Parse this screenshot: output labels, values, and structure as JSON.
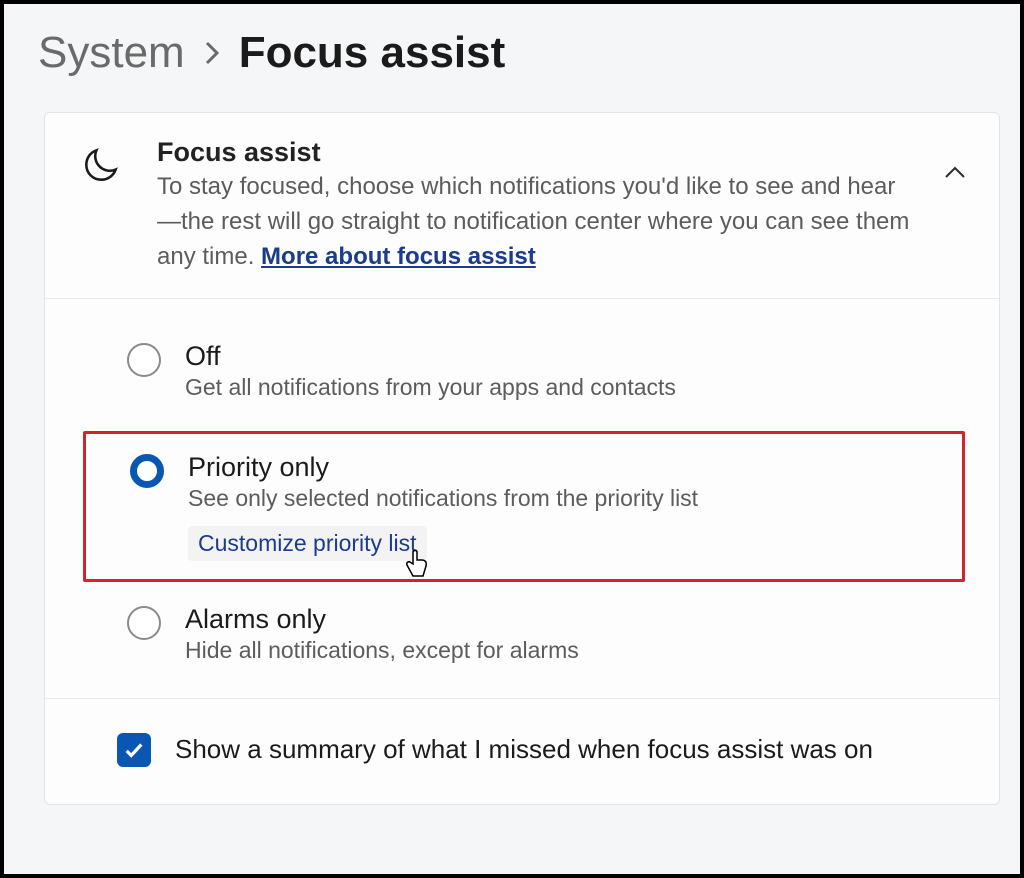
{
  "breadcrumb": {
    "parent": "System",
    "current": "Focus assist"
  },
  "header": {
    "title": "Focus assist",
    "description": "To stay focused, choose which notifications you'd like to see and hear—the rest will go straight to notification center where you can see them any time.  ",
    "link_label": "More about focus assist"
  },
  "options": {
    "off": {
      "title": "Off",
      "sub": "Get all notifications from your apps and contacts"
    },
    "priority": {
      "title": "Priority only",
      "sub": "See only selected notifications from the priority list",
      "customize_label": "Customize priority list"
    },
    "alarms": {
      "title": "Alarms only",
      "sub": "Hide all notifications, except for alarms"
    }
  },
  "summary_checkbox": {
    "label": "Show a summary of what I missed when focus assist was on"
  }
}
